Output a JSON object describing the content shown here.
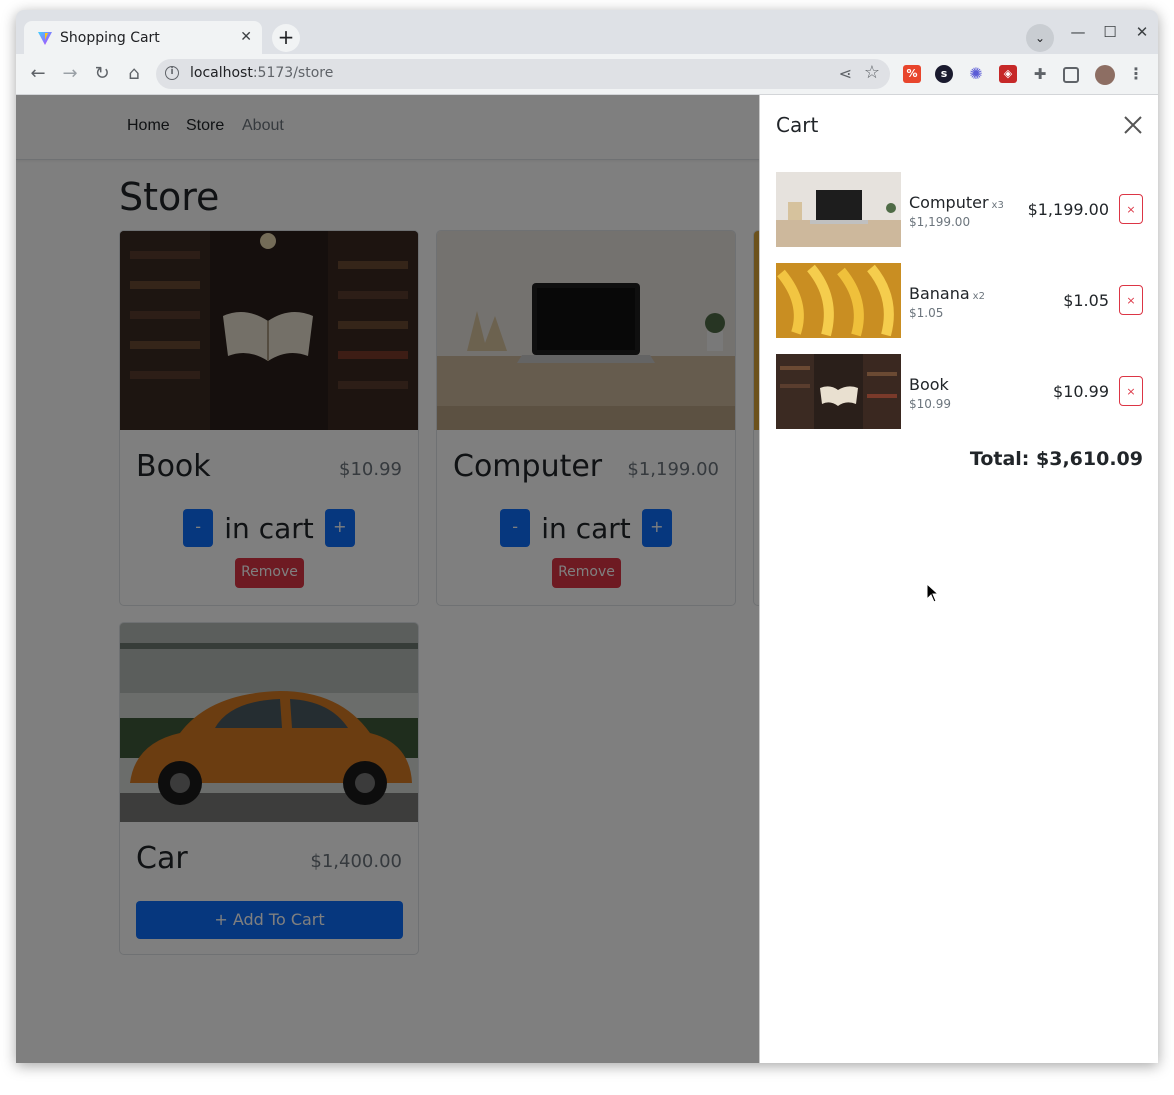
{
  "browser": {
    "tab_title": "Shopping Cart",
    "tab_close": "✕",
    "new_tab": "+",
    "url_host": "localhost",
    "url_path": ":5173/store"
  },
  "nav": {
    "links": [
      "Home",
      "Store",
      "About"
    ]
  },
  "store": {
    "title": "Store",
    "items": [
      {
        "name": "Book",
        "price": "$10.99",
        "in_cart_label": "in cart",
        "minus": "-",
        "plus": "+",
        "remove": "Remove"
      },
      {
        "name": "Computer",
        "price": "$1,199.00",
        "in_cart_label": "in cart",
        "minus": "-",
        "plus": "+",
        "remove": "Remove"
      },
      {
        "name": "Car",
        "price": "$1,400.00",
        "add_label": "+ Add To Cart"
      }
    ]
  },
  "cart": {
    "title": "Cart",
    "items": [
      {
        "name": "Computer",
        "qty": "x3",
        "unit_price": "$1,199.00",
        "total": "$1,199.00",
        "remove": "×"
      },
      {
        "name": "Banana",
        "qty": "x2",
        "unit_price": "$1.05",
        "total": "$1.05",
        "remove": "×"
      },
      {
        "name": "Book",
        "qty": "",
        "unit_price": "$10.99",
        "total": "$10.99",
        "remove": "×"
      }
    ],
    "total": "Total: $3,610.09"
  },
  "colors": {
    "primary": "#0d6efd",
    "danger": "#dc3545"
  }
}
